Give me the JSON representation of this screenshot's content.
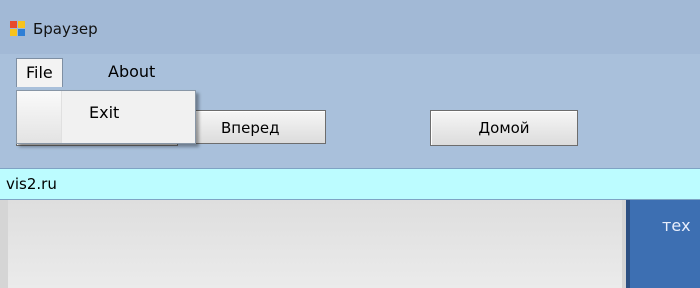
{
  "window": {
    "title": "Браузер",
    "icon": "app-window-icon"
  },
  "menu": {
    "items": [
      {
        "label": "File"
      },
      {
        "label": "About"
      }
    ],
    "file_dropdown": {
      "items": [
        {
          "label": "Exit"
        }
      ]
    }
  },
  "toolbar": {
    "forward_label": "Вперед",
    "home_label": "Домой"
  },
  "address_bar": {
    "value": "vis2.ru"
  },
  "web_content": {
    "panel_text": "тех"
  },
  "colors": {
    "titlebar": "#a2b9d6",
    "address_bar_bg": "#bcfcff",
    "web_panel": "#3d6fb2"
  }
}
